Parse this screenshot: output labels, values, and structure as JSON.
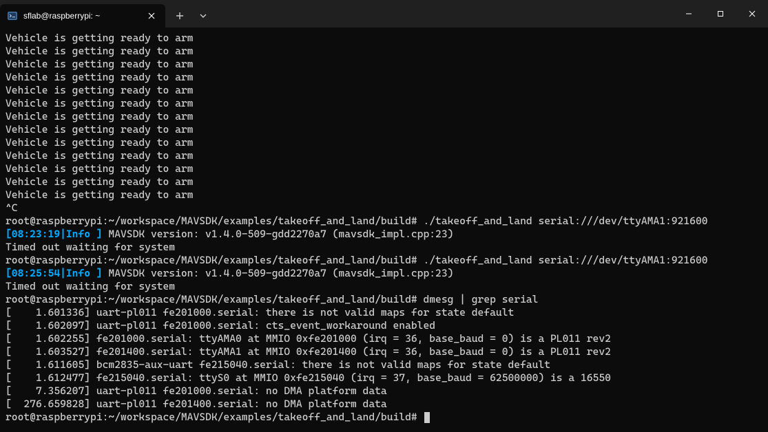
{
  "window": {
    "tab_title": "sflab@raspberrypi: ~",
    "tab_icon": "terminal-icon"
  },
  "terminal": {
    "repeated_arm_line": "Vehicle is getting ready to arm",
    "repeated_arm_count": 13,
    "interrupt": "^C",
    "prompt_path": "root@raspberrypi:~/workspace/MAVSDK/examples/takeoff_and_land/build#",
    "cmd_takeoff": "./takeoff_and_land serial:///dev/ttyAMA1:921600",
    "info1_ts": "[08:23:19|Info ]",
    "info1_msg": " MAVSDK version: v1.4.0-509-gdd2270a7 (mavsdk_impl.cpp:23)",
    "timed_out": "Timed out waiting for system",
    "info2_ts": "[08:25:54|Info ]",
    "info2_msg": " MAVSDK version: v1.4.0-509-gdd2270a7 (mavsdk_impl.cpp:23)",
    "cmd_dmesg": "dmesg | grep serial",
    "dmesg_lines": [
      "[    1.601336] uart-pl011 fe201000.serial: there is not valid maps for state default",
      "[    1.602097] uart-pl011 fe201000.serial: cts_event_workaround enabled",
      "[    1.602255] fe201000.serial: ttyAMA0 at MMIO 0xfe201000 (irq = 36, base_baud = 0) is a PL011 rev2",
      "[    1.603527] fe201400.serial: ttyAMA1 at MMIO 0xfe201400 (irq = 36, base_baud = 0) is a PL011 rev2",
      "[    1.611605] bcm2835-aux-uart fe215040.serial: there is not valid maps for state default",
      "[    1.612477] fe215040.serial: ttyS0 at MMIO 0xfe215040 (irq = 37, base_baud = 62500000) is a 16550",
      "[    7.356207] uart-pl011 fe201000.serial: no DMA platform data",
      "[  276.659828] uart-pl011 fe201400.serial: no DMA platform data"
    ]
  }
}
